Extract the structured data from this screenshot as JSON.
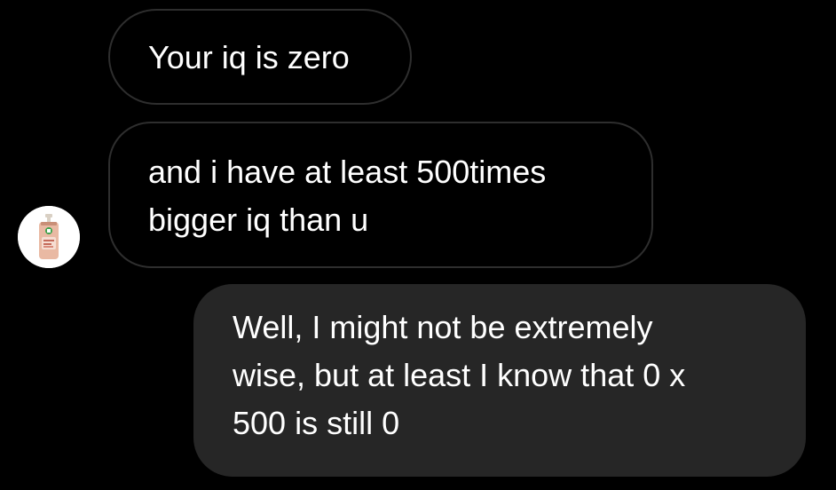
{
  "conversation": {
    "messages": [
      {
        "direction": "incoming",
        "lines": [
          "Your iq is zero"
        ]
      },
      {
        "direction": "incoming",
        "lines": [
          "and i have at least 500times",
          "bigger iq than u"
        ]
      },
      {
        "direction": "outgoing",
        "lines": [
          "Well, I might not be extremely",
          "wise, but at least I know that 0 x",
          "500 is still 0"
        ]
      }
    ],
    "sender_avatar_icon": "soap-bottle-icon"
  },
  "colors": {
    "background": "#000000",
    "incoming_border": "#2e2e2e",
    "outgoing_fill": "#262626",
    "text": "#ffffff"
  }
}
